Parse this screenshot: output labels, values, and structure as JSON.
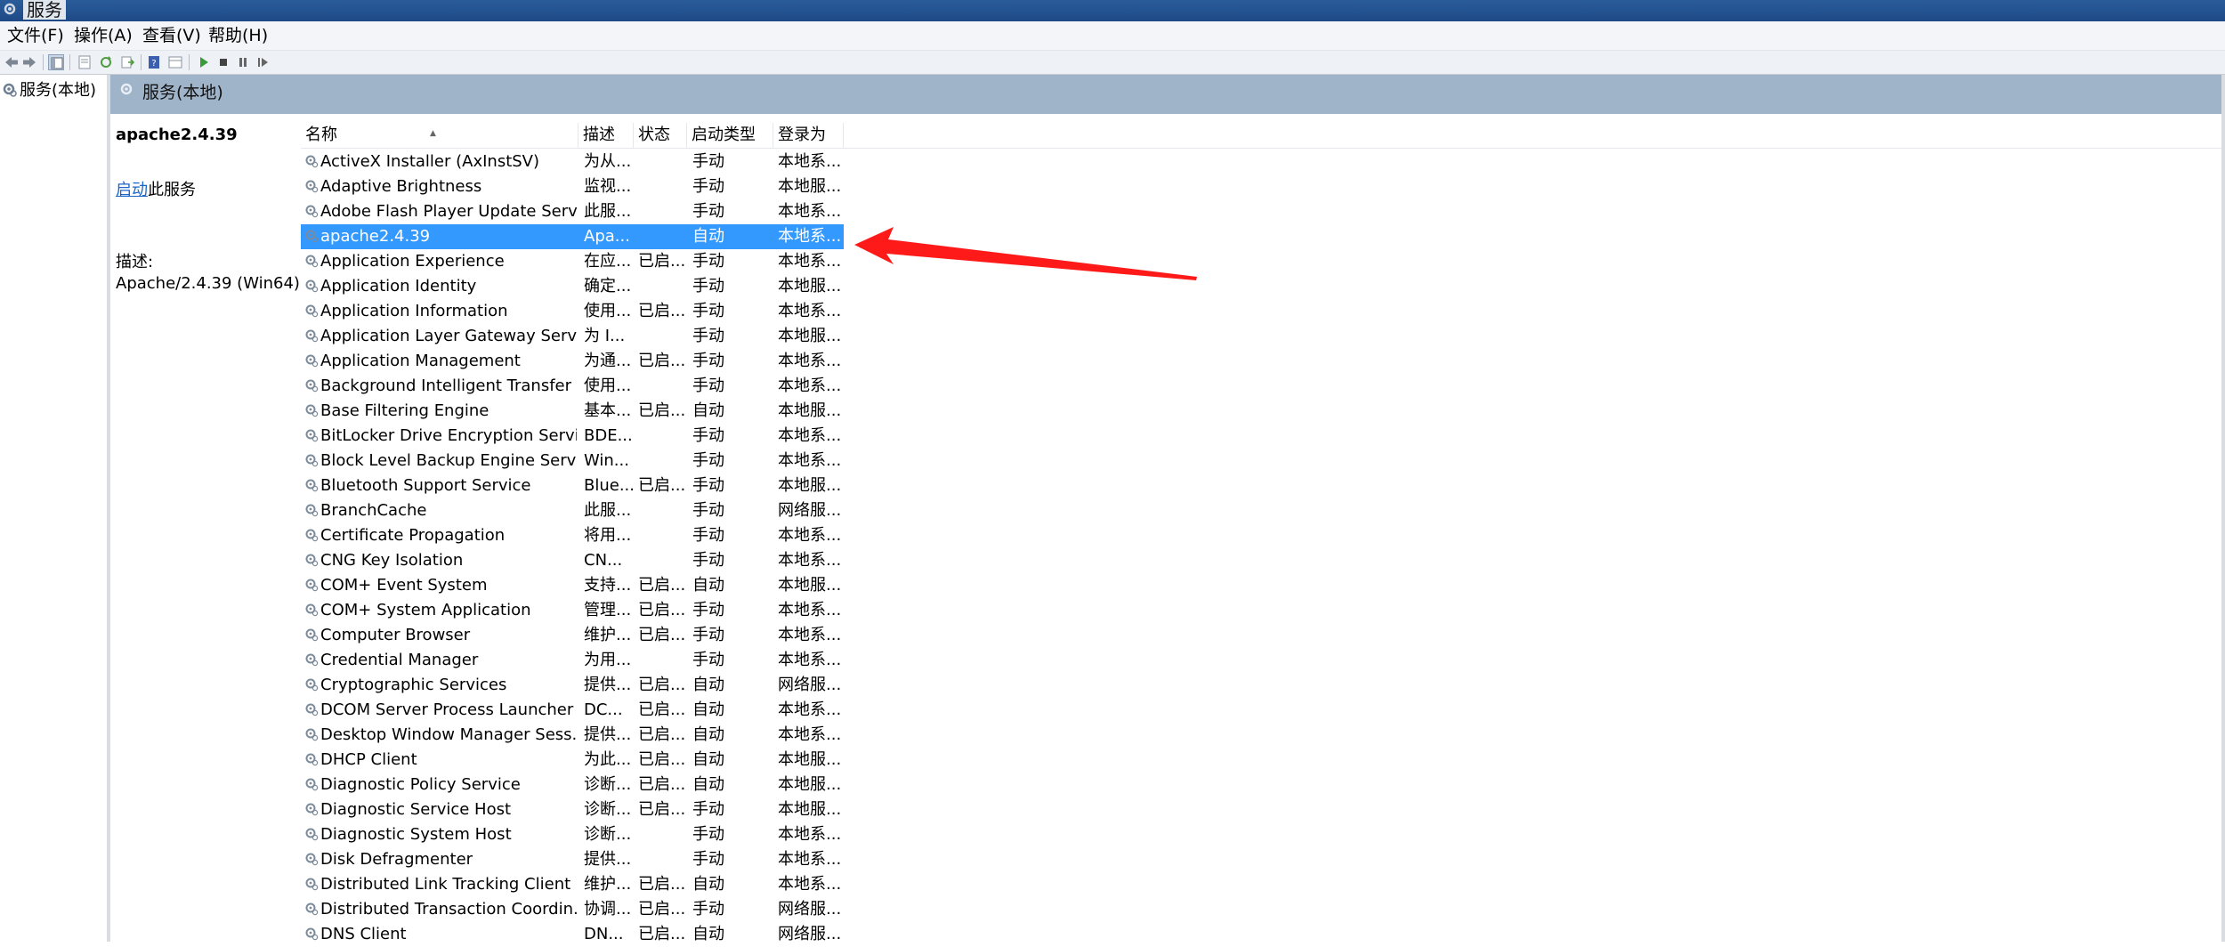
{
  "window": {
    "title": "服务"
  },
  "menu": {
    "file": "文件(F)",
    "action": "操作(A)",
    "view": "查看(V)",
    "help": "帮助(H)"
  },
  "toolbar": [
    "back-icon",
    "forward-icon",
    "show-hide-tree-icon",
    "properties-icon",
    "refresh-icon",
    "export-list-icon",
    "help-icon",
    "view-icon",
    "start-icon",
    "stop-icon",
    "pause-icon",
    "restart-icon"
  ],
  "tree": {
    "item": "服务(本地)"
  },
  "pane": {
    "title": "服务(本地)"
  },
  "detail": {
    "service_name": "apache2.4.39",
    "action_link": "启动",
    "action_suffix": "此服务",
    "desc_label": "描述:",
    "desc_text": "Apache/2.4.39 (Win64)"
  },
  "columns": {
    "name": "名称",
    "desc": "描述",
    "status": "状态",
    "startup": "启动类型",
    "logon": "登录为"
  },
  "rows": [
    {
      "name": "ActiveX Installer (AxInstSV)",
      "desc": "为从...",
      "status": "",
      "startup": "手动",
      "logon": "本地系..."
    },
    {
      "name": "Adaptive Brightness",
      "desc": "监视...",
      "status": "",
      "startup": "手动",
      "logon": "本地服..."
    },
    {
      "name": "Adobe Flash Player Update Serv...",
      "desc": "此服...",
      "status": "",
      "startup": "手动",
      "logon": "本地系..."
    },
    {
      "name": "apache2.4.39",
      "desc": "Apa...",
      "status": "",
      "startup": "自动",
      "logon": "本地系...",
      "selected": true
    },
    {
      "name": "Application Experience",
      "desc": "在应...",
      "status": "已启...",
      "startup": "手动",
      "logon": "本地系..."
    },
    {
      "name": "Application Identity",
      "desc": "确定...",
      "status": "",
      "startup": "手动",
      "logon": "本地服..."
    },
    {
      "name": "Application Information",
      "desc": "使用...",
      "status": "已启...",
      "startup": "手动",
      "logon": "本地系..."
    },
    {
      "name": "Application Layer Gateway Servi...",
      "desc": "为 I...",
      "status": "",
      "startup": "手动",
      "logon": "本地服..."
    },
    {
      "name": "Application Management",
      "desc": "为通...",
      "status": "已启...",
      "startup": "手动",
      "logon": "本地系..."
    },
    {
      "name": "Background Intelligent Transfer ...",
      "desc": "使用...",
      "status": "",
      "startup": "手动",
      "logon": "本地系..."
    },
    {
      "name": "Base Filtering Engine",
      "desc": "基本...",
      "status": "已启...",
      "startup": "自动",
      "logon": "本地服..."
    },
    {
      "name": "BitLocker Drive Encryption Servi...",
      "desc": "BDE...",
      "status": "",
      "startup": "手动",
      "logon": "本地系..."
    },
    {
      "name": "Block Level Backup Engine Servi...",
      "desc": "Win...",
      "status": "",
      "startup": "手动",
      "logon": "本地系..."
    },
    {
      "name": "Bluetooth Support Service",
      "desc": "Blue...",
      "status": "已启...",
      "startup": "手动",
      "logon": "本地服..."
    },
    {
      "name": "BranchCache",
      "desc": "此服...",
      "status": "",
      "startup": "手动",
      "logon": "网络服..."
    },
    {
      "name": "Certificate Propagation",
      "desc": "将用...",
      "status": "",
      "startup": "手动",
      "logon": "本地系..."
    },
    {
      "name": "CNG Key Isolation",
      "desc": "CN...",
      "status": "",
      "startup": "手动",
      "logon": "本地系..."
    },
    {
      "name": "COM+ Event System",
      "desc": "支持...",
      "status": "已启...",
      "startup": "自动",
      "logon": "本地服..."
    },
    {
      "name": "COM+ System Application",
      "desc": "管理...",
      "status": "已启...",
      "startup": "手动",
      "logon": "本地系..."
    },
    {
      "name": "Computer Browser",
      "desc": "维护...",
      "status": "已启...",
      "startup": "手动",
      "logon": "本地系..."
    },
    {
      "name": "Credential Manager",
      "desc": "为用...",
      "status": "",
      "startup": "手动",
      "logon": "本地系..."
    },
    {
      "name": "Cryptographic Services",
      "desc": "提供...",
      "status": "已启...",
      "startup": "自动",
      "logon": "网络服..."
    },
    {
      "name": "DCOM Server Process Launcher",
      "desc": "DC...",
      "status": "已启...",
      "startup": "自动",
      "logon": "本地系..."
    },
    {
      "name": "Desktop Window Manager Sess...",
      "desc": "提供...",
      "status": "已启...",
      "startup": "自动",
      "logon": "本地系..."
    },
    {
      "name": "DHCP Client",
      "desc": "为此...",
      "status": "已启...",
      "startup": "自动",
      "logon": "本地服..."
    },
    {
      "name": "Diagnostic Policy Service",
      "desc": "诊断...",
      "status": "已启...",
      "startup": "自动",
      "logon": "本地服..."
    },
    {
      "name": "Diagnostic Service Host",
      "desc": "诊断...",
      "status": "已启...",
      "startup": "手动",
      "logon": "本地服..."
    },
    {
      "name": "Diagnostic System Host",
      "desc": "诊断...",
      "status": "",
      "startup": "手动",
      "logon": "本地系..."
    },
    {
      "name": "Disk Defragmenter",
      "desc": "提供...",
      "status": "",
      "startup": "手动",
      "logon": "本地系..."
    },
    {
      "name": "Distributed Link Tracking Client",
      "desc": "维护...",
      "status": "已启...",
      "startup": "自动",
      "logon": "本地系..."
    },
    {
      "name": "Distributed Transaction Coordin...",
      "desc": "协调...",
      "status": "已启...",
      "startup": "手动",
      "logon": "网络服..."
    },
    {
      "name": "DNS Client",
      "desc": "DN...",
      "status": "已启...",
      "startup": "自动",
      "logon": "网络服..."
    }
  ],
  "colors": {
    "selection": "#3399ff",
    "pane_header": "#9fb3c9",
    "link": "#1a66c8",
    "arrow": "#ff1a1a"
  }
}
